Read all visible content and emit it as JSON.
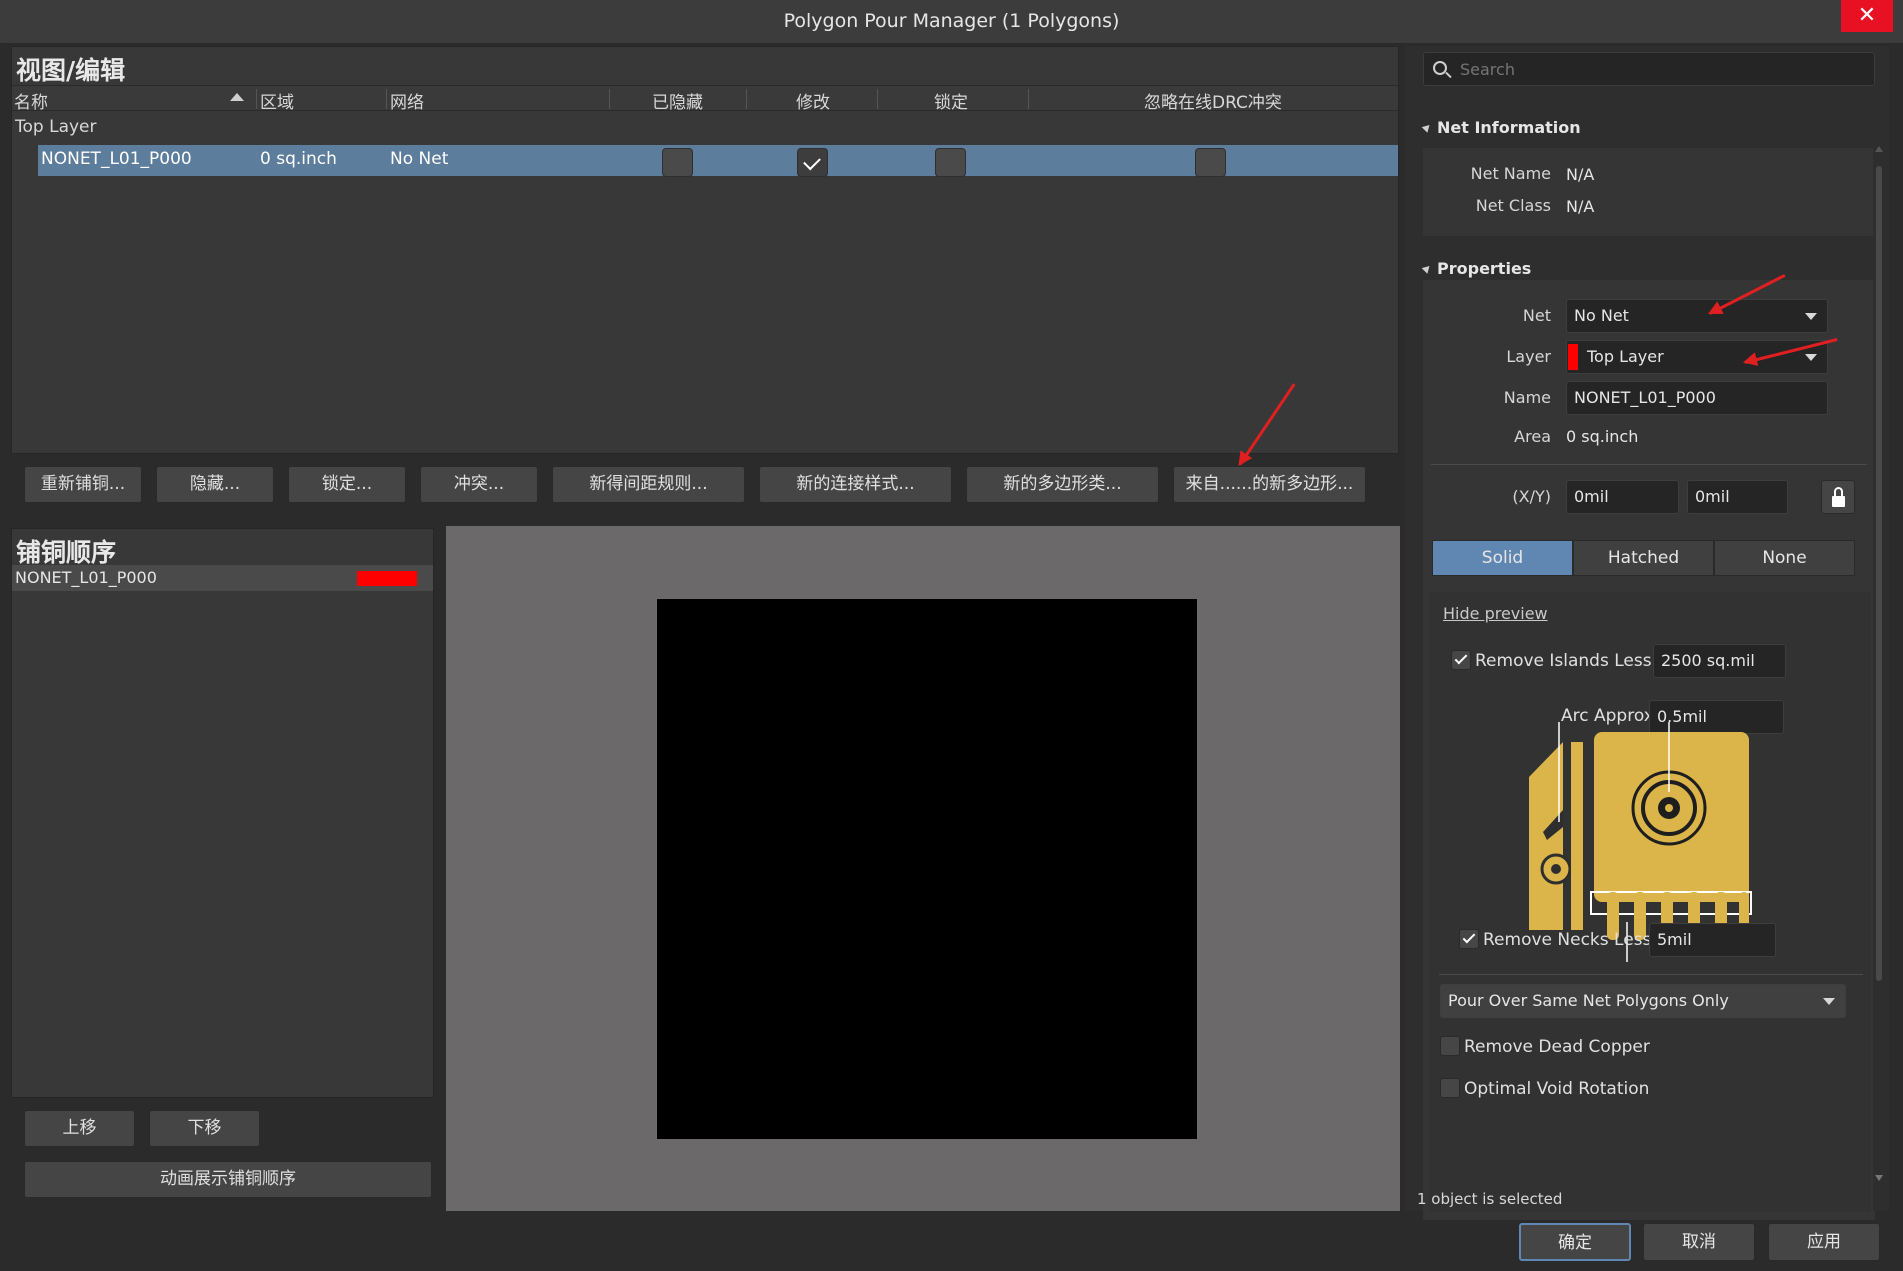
{
  "window": {
    "title": "Polygon Pour Manager (1 Polygons)",
    "close_glyph": "✕"
  },
  "view_edit": {
    "title": "视图/编辑",
    "columns": [
      "名称",
      "区域",
      "网络",
      "已隐藏",
      "修改",
      "锁定",
      "忽略在线DRC冲突"
    ],
    "group_label": "Top Layer",
    "row": {
      "name": "NONET_L01_P000",
      "area": "0 sq.inch",
      "net": "No Net",
      "hidden": false,
      "modify": true,
      "locked": false,
      "ignore_drc": false
    }
  },
  "action_buttons": [
    "重新铺铜...",
    "隐藏...",
    "锁定...",
    "冲突...",
    "新得间距规则...",
    "新的连接样式...",
    "新的多边形类...",
    "来自......的新多边形..."
  ],
  "pour_order": {
    "title": "铺铜顺序",
    "item": {
      "name": "NONET_L01_P000",
      "color": "#ff0000"
    },
    "move_up": "上移",
    "move_down": "下移",
    "animate": "动画展示铺铜顺序"
  },
  "right": {
    "search_placeholder": "Search",
    "net_info": {
      "header": "Net Information",
      "net_name_label": "Net Name",
      "net_name": "N/A",
      "net_class_label": "Net Class",
      "net_class": "N/A"
    },
    "properties": {
      "header": "Properties",
      "net_label": "Net",
      "net": "No Net",
      "layer_label": "Layer",
      "layer": "Top Layer",
      "layer_color": "#ff0000",
      "name_label": "Name",
      "name": "NONET_L01_P000",
      "area_label": "Area",
      "area": "0 sq.inch",
      "xy_label": "(X/Y)",
      "x": "0mil",
      "y": "0mil"
    },
    "fill_modes": [
      "Solid",
      "Hatched",
      "None"
    ],
    "active_fill": "Solid",
    "hide_preview": "Hide preview",
    "remove_islands_label": "Remove Islands Less Than",
    "remove_islands_value": "2500 sq.mil",
    "arc_approx_label": "Arc Approx.",
    "arc_approx_value": "0.5mil",
    "remove_necks_label": "Remove Necks Less Than",
    "remove_necks_value": "5mil",
    "pour_over": "Pour Over Same Net Polygons Only",
    "remove_dead_copper": "Remove Dead Copper",
    "optimal_void_rotation": "Optimal Void Rotation"
  },
  "status": "1 object is selected",
  "footer": {
    "ok": "确定",
    "cancel": "取消",
    "apply": "应用"
  },
  "colors": {
    "selection": "#5d7d9c",
    "accent": "#5f87b2",
    "copper": "#dcb54a",
    "annotation_red": "#e02020"
  }
}
